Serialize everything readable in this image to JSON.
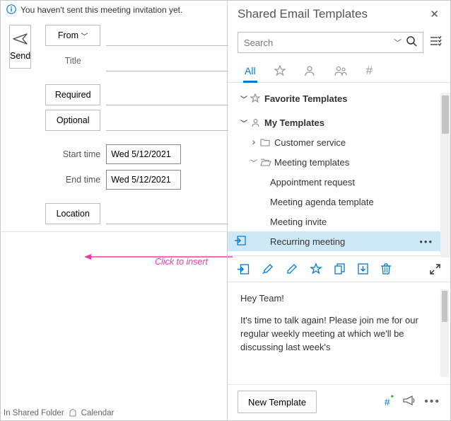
{
  "info_bar": {
    "text": "You haven't sent this meeting invitation yet."
  },
  "compose": {
    "send": "Send",
    "from_label": "From",
    "title_label": "Title",
    "required_label": "Required",
    "optional_label": "Optional",
    "start_label": "Start time",
    "end_label": "End time",
    "start_value": "Wed 5/12/2021",
    "end_value": "Wed 5/12/2021",
    "location_label": "Location"
  },
  "status_bar": {
    "folder": "In Shared Folder",
    "view": "Calendar"
  },
  "annotation": {
    "text": "Click to insert",
    "color": "#e83ba9"
  },
  "panel": {
    "title": "Shared Email Templates",
    "search_placeholder": "Search",
    "tabs": {
      "all": "All"
    }
  },
  "tree": {
    "favorites": "Favorite Templates",
    "my_templates": "My Templates",
    "customer_service": "Customer service",
    "meeting_templates": "Meeting templates",
    "items": {
      "appointment": "Appointment request",
      "agenda": "Meeting agenda template",
      "invite": "Meeting invite",
      "recurring": "Recurring meeting"
    }
  },
  "preview": {
    "greeting": "Hey Team!",
    "body": "It's time to talk again! Please join me for our regular weekly meeting at which we'll be discussing last week's"
  },
  "bottom": {
    "new_template": "New Template"
  },
  "colors": {
    "accent": "#0078d4"
  }
}
